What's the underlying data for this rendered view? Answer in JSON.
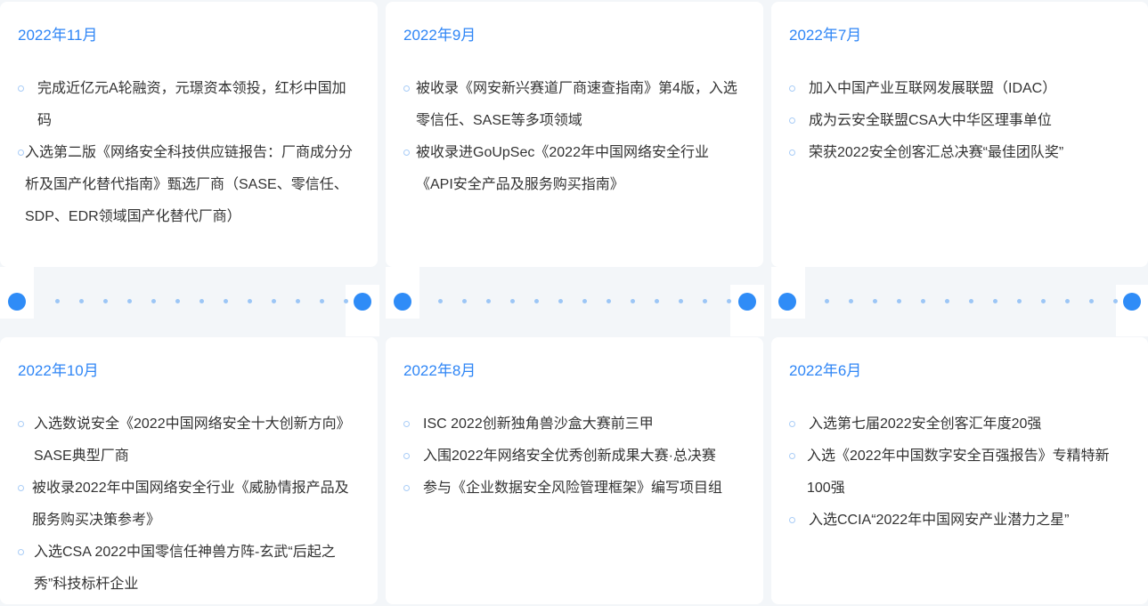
{
  "timeline": {
    "top": [
      {
        "date": "2022年11月",
        "items": [
          "完成近亿元A轮融资，元璟资本领投，红杉中国加码",
          "入选第二版《网络安全科技供应链报告：厂商成分分析及国产化替代指南》甄选厂商（SASE、零信任、SDP、EDR领域国产化替代厂商）"
        ]
      },
      {
        "date": "2022年9月",
        "items": [
          "被收录《网安新兴赛道厂商速查指南》第4版，入选零信任、SASE等多项领域",
          "被收录进GoUpSec《2022年中国网络安全行业《API安全产品及服务购买指南》"
        ]
      },
      {
        "date": "2022年7月",
        "items": [
          "加入中国产业互联网发展联盟（IDAC）",
          "成为云安全联盟CSA大中华区理事单位",
          "荣获2022安全创客汇总决赛“最佳团队奖”"
        ]
      }
    ],
    "bottom": [
      {
        "date": "2022年10月",
        "items": [
          "入选数说安全《2022中国网络安全十大创新方向》SASE典型厂商",
          "被收录2022年中国网络安全行业《威胁情报产品及服务购买决策参考》",
          "入选CSA 2022中国零信任神兽方阵-玄武“后起之秀”科技标杆企业"
        ]
      },
      {
        "date": "2022年8月",
        "items": [
          "ISC 2022创新独角兽沙盒大赛前三甲",
          "入围2022年网络安全优秀创新成果大赛·总决赛",
          "参与《企业数据安全风险管理框架》编写项目组"
        ]
      },
      {
        "date": "2022年6月",
        "items": [
          "入选第七届2022安全创客汇年度20强",
          "入选《2022年中国数字安全百强报告》专精特新100强",
          "入选CCIA“2022年中国网安产业潜力之星”"
        ]
      }
    ]
  }
}
